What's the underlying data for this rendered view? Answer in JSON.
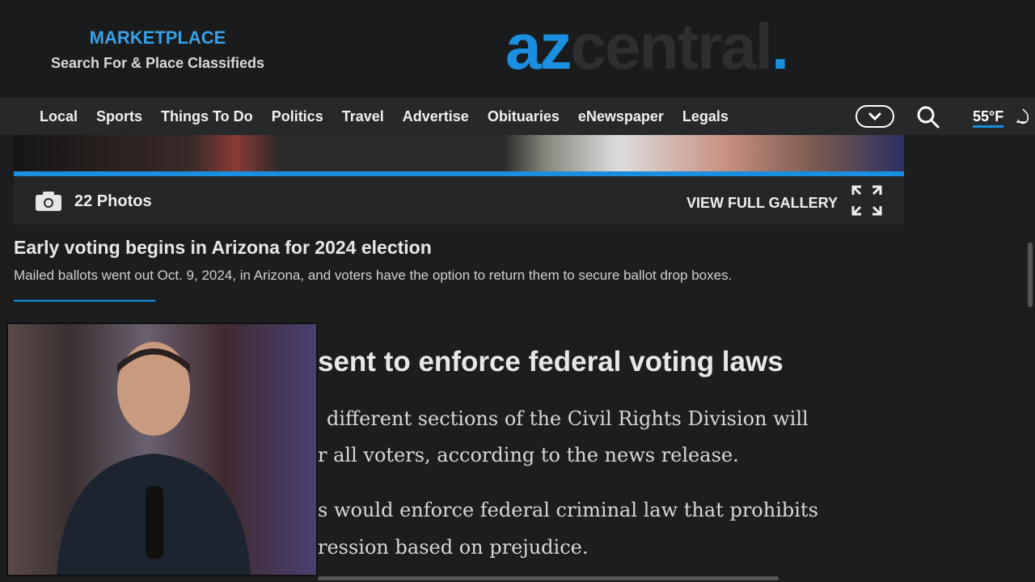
{
  "header": {
    "marketplace_title": "MARKETPLACE",
    "marketplace_sub": "Search For & Place Classifieds",
    "logo": "azcentral."
  },
  "nav": {
    "items": [
      "Local",
      "Sports",
      "Things To Do",
      "Politics",
      "Travel",
      "Advertise",
      "Obituaries",
      "eNewspaper",
      "Legals"
    ],
    "temperature": "55°F"
  },
  "gallery": {
    "count": "22 Photos",
    "view_full": "VIEW FULL GALLERY"
  },
  "caption": {
    "title": "Early voting begins in Arizona for 2024 election",
    "text": "Mailed ballots went out Oct. 9, 2024, in Arizona, and voters have the option to return them to secure ballot drop boxes."
  },
  "article": {
    "heading": "sent to enforce federal voting laws",
    "p1a": "different sections of the Civil Rights Division will",
    "p1b": "r all voters, according to the news release.",
    "p2a": "s would enforce federal criminal law that prohibits",
    "p2b": "ression based on prejudice."
  },
  "colors": {
    "accent": "#1a8fe0"
  }
}
